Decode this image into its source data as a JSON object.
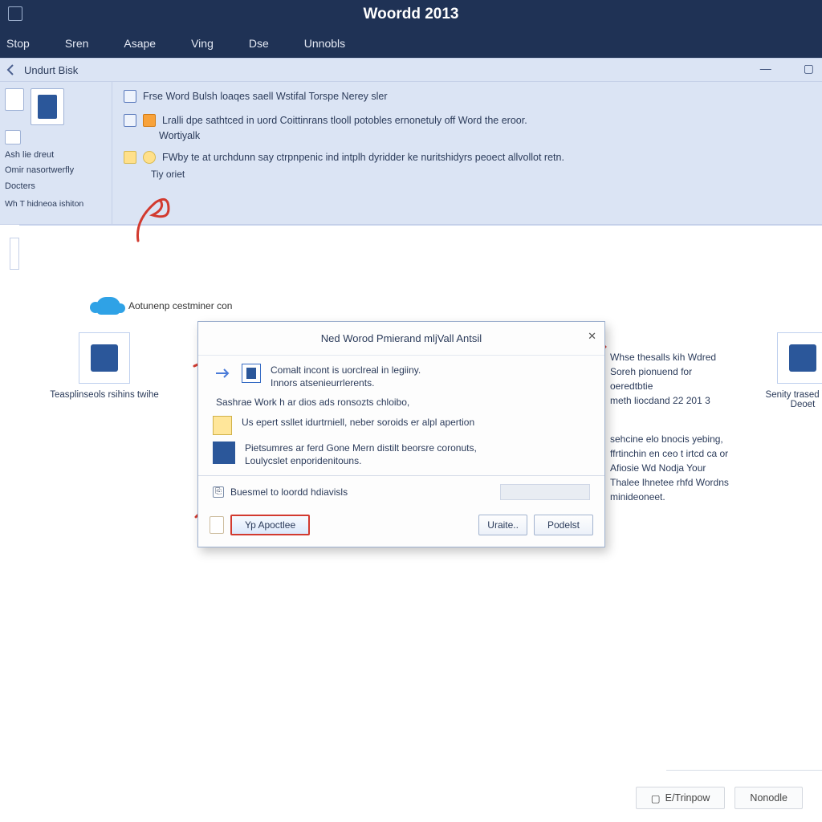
{
  "title": "Woordd 2013",
  "menu": {
    "i0": "Stop",
    "i1": "Sren",
    "i2": "Asape",
    "i3": "Ving",
    "i4": "Dse",
    "i5": "Unnobls"
  },
  "subrow": {
    "title": "Undurt Bisk",
    "min": "—",
    "max": "▢"
  },
  "panel_left": {
    "l1": "Ash lie dreut",
    "l2": "Omir nasortwerfly",
    "opts": "Docters",
    "hint": "Wh T hidneoa ishiton"
  },
  "info": {
    "a": "Frse Word Bulsh loaqes saell Wstifal Torspe Nerey sler",
    "b": "Lralli dpe sathtced in uord Coittinrans tlooll potobles ernonetuly off Word the eroor.",
    "bw": "Wortiyalk",
    "c": "FWby te at urchdunn say ctrpnpenic ind intplh dyridder ke nuritshidyrs peoect allvollot retn.",
    "ty": "Tiy oriet"
  },
  "cloud": "Aotunenp cestminer con",
  "cardA": "Teasplinseols rsihins twihe",
  "cardB": {
    "l1": "Senity trased Was",
    "l2": "Deoet"
  },
  "rtxt": {
    "l1": "Whse thesalls kih Wdred",
    "l2": "Soreh pionuend for oeredtbtie",
    "l3": "meth liocdand 22 201 3",
    "l4": "sehcine elo bnocis yebing,",
    "l5": "ffrtinchin en ceo t irtcd ca or",
    "l6": "Afiosie Wd Nodja Your",
    "l7": "Thalee lhnetee rhfd Wordns",
    "l8": "minideoneet."
  },
  "dialog": {
    "title": "Ned Worod Pmierand mljVall Antsil",
    "r1a": "Comalt incont is uorclreal in legiiny.",
    "r1b": "Innors atsenieurrlerents.",
    "r2": "Sashrae Work h ar dios ads ronsozts chloibo,",
    "r3": "Us epert ssllet idurtrniell, neber soroids er alpl apertion",
    "r4a": "Pietsumres ar ferd Gone Mern distilt beorsre coronuts,",
    "r4b": "Loulycslet enporidenitouns.",
    "chk": "Buesmel to loordd hdiavisls",
    "ok": "Yp Apoctlee",
    "mid": "Uraite..",
    "right": "Podelst"
  },
  "status": {
    "a": "E/Trinpow",
    "b": "Nonodle"
  }
}
